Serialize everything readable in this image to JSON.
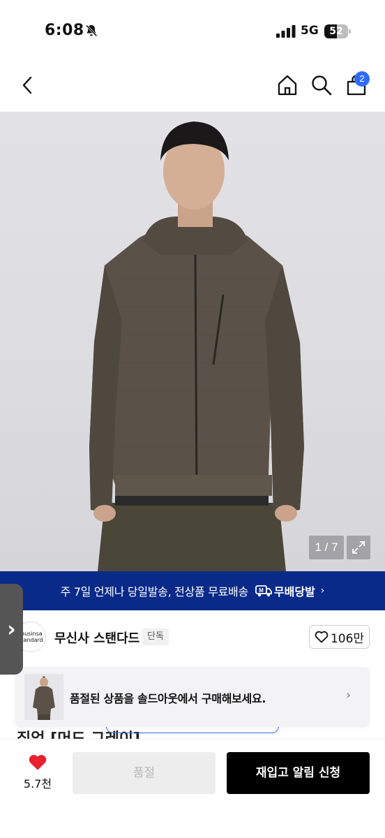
{
  "status_bar": {
    "time": "6:08",
    "network": "5G",
    "battery": "52",
    "battery_level_percent": 52,
    "icons": [
      "bell-slash-icon",
      "signal-icon"
    ]
  },
  "nav": {
    "icons": [
      "back-chevron-icon",
      "home-icon",
      "search-icon",
      "shopping-bag-icon"
    ],
    "cart_count": "2"
  },
  "gallery": {
    "counter": "1 / 7",
    "icons": [
      "expand-icon"
    ]
  },
  "promo": {
    "text": "주 7일 언제나 당일발송, 전상품 무료배송",
    "logo_text": "무배당발",
    "logo_mark": "M",
    "chevron": "›",
    "background_color": "#0a2a8a"
  },
  "brand": {
    "logo_line1": "musinsa",
    "logo_line2": "standard",
    "name": "무신사 스탠다드",
    "tag": "단독",
    "likes": "106만",
    "side_tab": "›"
  },
  "toast": {
    "message": "품절된 상품을 솔드아웃에서 구매해보세요.",
    "chevron": "›"
  },
  "product": {
    "partial_title": "집업 [머드 그레이]"
  },
  "bottom_bar": {
    "wish_count": "5.7천",
    "soldout_label": "품절",
    "restock_label": "재입고 알림 신청",
    "heart_color": "#e8212e"
  }
}
